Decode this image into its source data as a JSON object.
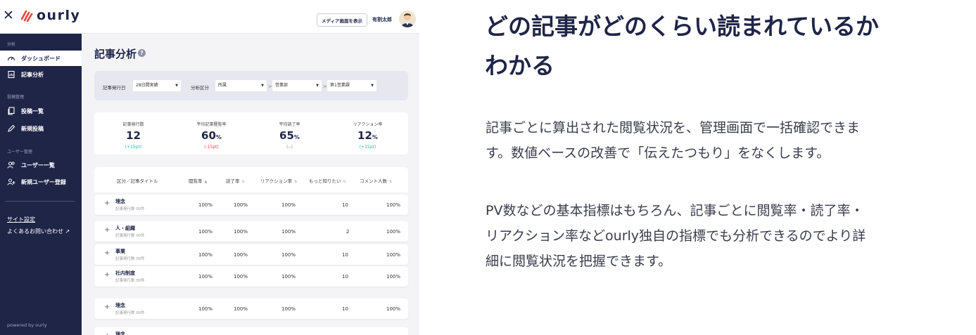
{
  "app": {
    "close_glyph": "✕",
    "logo_text": "ourly",
    "brand_color": "#1f2547",
    "accent_color": "#e8453c"
  },
  "sidebar": {
    "section_analysis": "分析",
    "item_dashboard": "ダッシュボード",
    "item_article_analysis": "記事分析",
    "section_posts": "投稿管理",
    "item_post_list": "投稿一覧",
    "item_new_post": "新規投稿",
    "section_users": "ユーザー管理",
    "item_user_list": "ユーザー一覧",
    "item_new_user": "新規ユーザー登録",
    "site_settings": "サイト設定",
    "faq": "よくあるお問い合わせ",
    "faq_icon": "↗",
    "powered_by": "powered by ourly"
  },
  "topbar": {
    "media_button": "メディア画面を表示",
    "username": "有割太郎"
  },
  "page": {
    "title": "記事分析",
    "help_glyph": "?"
  },
  "filters": {
    "date_label": "記事発行日",
    "date_value": "28日間実績",
    "category_label": "分析区分",
    "category_value": "所属",
    "level2_value": "営業部",
    "level3_value": "第1営業課",
    "separator": ">"
  },
  "kpis": [
    {
      "label": "記事発行数",
      "value": "12",
      "unit": "",
      "delta": "(+15pt)",
      "delta_color": "#2bb5a0"
    },
    {
      "label": "平均記事閲覧率",
      "value": "60",
      "unit": "%",
      "delta": "(-15pt)",
      "delta_color": "#e8453c"
    },
    {
      "label": "平均読了率",
      "value": "65",
      "unit": "%",
      "delta": "(--)",
      "delta_color": "#888888"
    },
    {
      "label": "リアクション率",
      "value": "12",
      "unit": "%",
      "delta": "(+15pt)",
      "delta_color": "#2bb5a0"
    }
  ],
  "table": {
    "headers": [
      "区分／記事タイトル",
      "閲覧率",
      "読了率",
      "リアクション率",
      "もっと知りたい",
      "コメント人数"
    ],
    "sort_up": "▲",
    "sort_both": "⇅",
    "rows": [
      {
        "title": "理念",
        "sub": "記事発行数 00件",
        "view": "100%",
        "read": "100%",
        "reaction": "100%",
        "more": "10",
        "comments": "100%"
      },
      {
        "title": "人・組織",
        "sub": "記事発行数 00件",
        "view": "100%",
        "read": "100%",
        "reaction": "100%",
        "more": "2",
        "comments": "100%"
      },
      {
        "title": "事業",
        "sub": "記事発行数 00件",
        "view": "100%",
        "read": "100%",
        "reaction": "100%",
        "more": "10",
        "comments": "100%"
      },
      {
        "title": "社内制度",
        "sub": "記事発行数 00件",
        "view": "100%",
        "read": "100%",
        "reaction": "100%",
        "more": "10",
        "comments": "100%"
      },
      {
        "title": "理念",
        "sub": "記事発行数 00件",
        "view": "100%",
        "read": "100%",
        "reaction": "100%",
        "more": "10",
        "comments": "100%"
      },
      {
        "title": "理念",
        "sub": "",
        "view": "",
        "read": "",
        "reaction": "",
        "more": "",
        "comments": ""
      }
    ]
  },
  "marketing": {
    "headline_line1": "どの記事がどのくらい読まれているか",
    "headline_line2": "わかる",
    "para1_line1": "記事ごとに算出された閲覧状況を、管理画面で一括確認できま",
    "para1_line2": "す。数値ベースの改善で「伝えたつもり」をなくします。",
    "para2_line1": "PV数などの基本指標はもちろん、記事ごとに閲覧率・読了率・",
    "para2_line2": "リアクション率などourly独自の指標でも分析できるのでより詳",
    "para2_line3": "細に閲覧状況を把握できます。"
  }
}
